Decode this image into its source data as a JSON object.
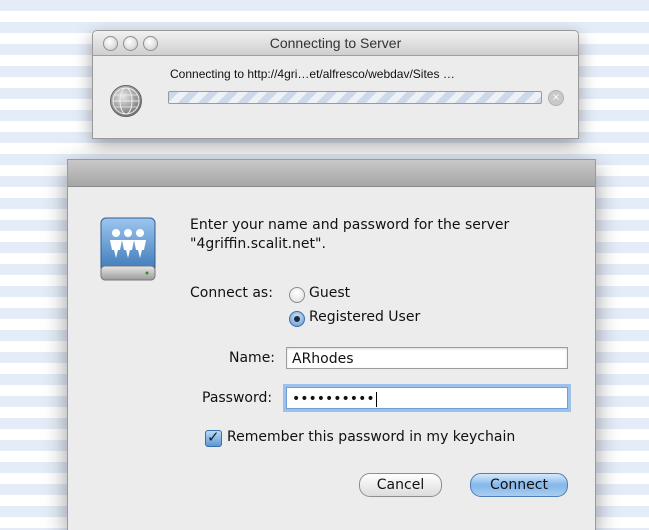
{
  "progress_window": {
    "title": "Connecting to Server",
    "message": "Connecting to http://4gri…et/alfresco/webdav/Sites …",
    "stop_glyph": "×"
  },
  "login": {
    "message_line1": "Enter your name and password for the server",
    "message_line2": "\"4griffin.scalit.net\".",
    "connect_as_label": "Connect as:",
    "options": [
      "Guest",
      "Registered User"
    ],
    "selected_option": "Registered User",
    "name_label": "Name:",
    "name_value": "ARhodes",
    "password_label": "Password:",
    "password_value": "••••••••••",
    "remember_label": "Remember this password in my keychain",
    "remember_checked": true,
    "cancel_label": "Cancel",
    "connect_label": "Connect"
  },
  "icons": [
    "globe-icon",
    "network-server-icon",
    "stop-icon",
    "close-icon",
    "minimize-icon",
    "zoom-icon"
  ]
}
